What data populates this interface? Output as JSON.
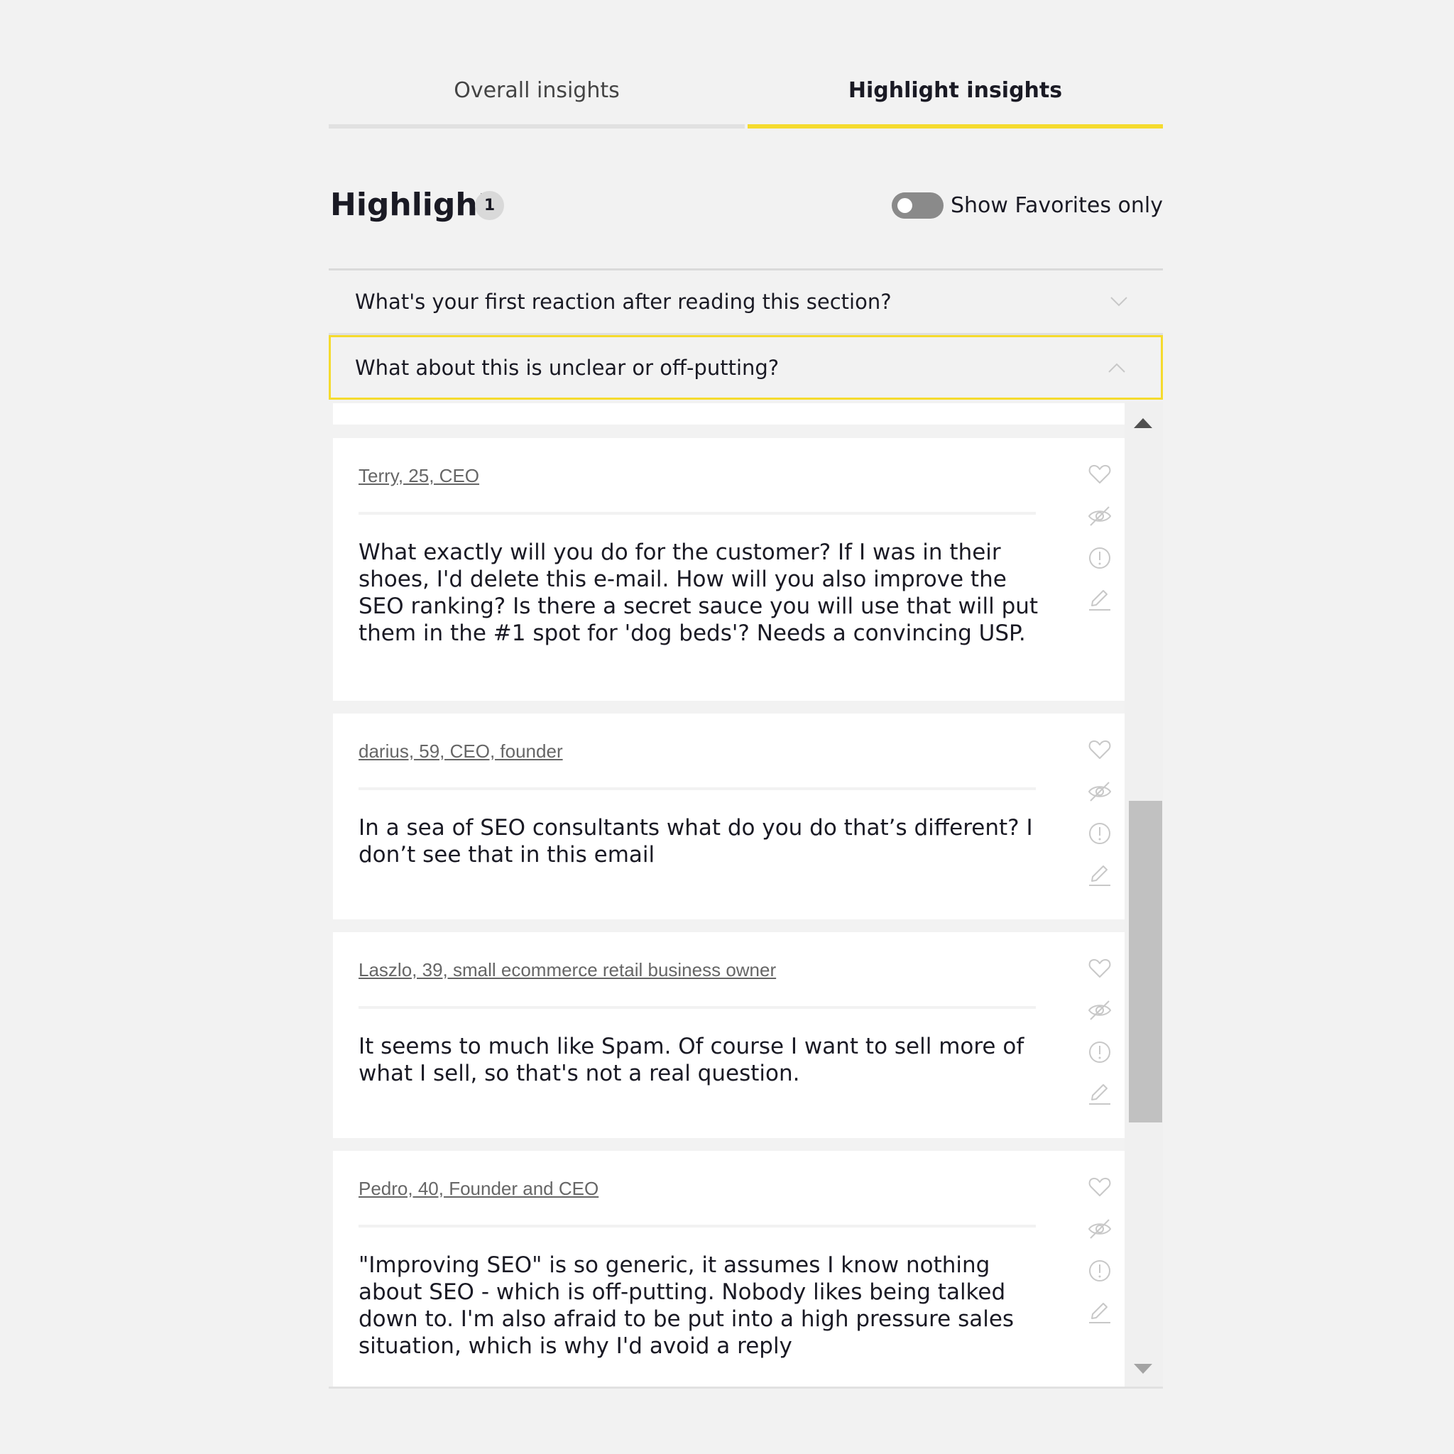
{
  "tabs": [
    {
      "label": "Overall insights",
      "active": false
    },
    {
      "label": "Highlight insights",
      "active": true
    }
  ],
  "heading": {
    "title": "Highlight",
    "count": "1"
  },
  "favorites_toggle": {
    "label": "Show Favorites only",
    "checked": false
  },
  "accordion": [
    {
      "question": "What's your first reaction after reading this section?",
      "expanded": false,
      "icon": "chevron-down-icon"
    },
    {
      "question": "What about this is unclear or off-putting?",
      "expanded": true,
      "icon": "chevron-up-icon"
    }
  ],
  "cards": [
    {
      "author": "Terry, 25, CEO",
      "text": "What exactly will you do for the customer? If I was in their shoes, I'd delete this e-mail. How will you also improve the SEO ranking? Is there a secret sauce you will use that will put them in the #1 spot for 'dog beds'? Needs a convincing USP."
    },
    {
      "author": "darius, 59, CEO, founder",
      "text": "In a sea of SEO consultants what do you do that’s different? I don’t see that in this email"
    },
    {
      "author": "Laszlo, 39, small ecommerce retail business owner",
      "text": "It seems to much like Spam. Of course I want to sell more of what I sell, so that's not a real question."
    },
    {
      "author": "Pedro, 40, Founder and CEO",
      "text": "\"Improving SEO\" is so generic, it assumes I know nothing about SEO - which is off-putting. Nobody likes being talked down to. I'm also afraid to be put into a high pressure sales situation, which is why I'd avoid a reply"
    }
  ],
  "card_actions": [
    "heart-icon",
    "eye-off-icon",
    "alert-circle-icon",
    "pencil-icon"
  ],
  "scrollbar": {
    "scroll_position_fraction": 0.61,
    "visible_fraction": 0.35
  },
  "colors": {
    "accent": "#f5db2e",
    "background": "#f2f2f2",
    "card": "#ffffff",
    "text": "#1a1a24",
    "muted": "#666666",
    "icon": "#c8c8c8"
  }
}
